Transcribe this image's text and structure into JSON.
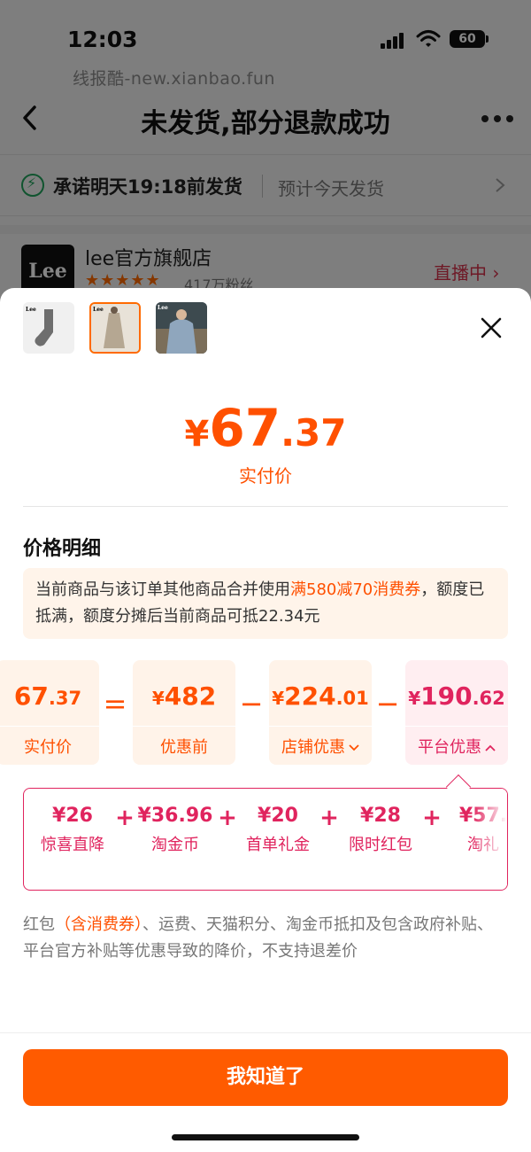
{
  "status_bar": {
    "time": "12:03",
    "battery": "60"
  },
  "watermark": "线报酷-new.xianbao.fun",
  "header": {
    "title": "未发货,部分退款成功"
  },
  "delivery": {
    "promise": "承诺明天19:18前发货",
    "estimate": "预计今天发货"
  },
  "store": {
    "logo_text": "Lee",
    "name": "lee官方旗舰店",
    "fans": "417万粉丝",
    "live_label": "直播中 ›"
  },
  "sheet": {
    "thumbnails": [
      "sock-product",
      "dress-product",
      "jacket-product"
    ],
    "price": {
      "currency": "¥",
      "integer": "67",
      "decimal": ".37",
      "label": "实付价"
    },
    "section_title": "价格明细",
    "notice": {
      "before": "当前商品与该订单其他商品合并使用",
      "highlight": "满580减70消费券",
      "after": "，额度已抵满，额度分摊后当前商品可抵22.34元"
    },
    "formula": [
      {
        "currency": "",
        "integer": "67",
        "decimal": ".37",
        "label": "实付价"
      },
      {
        "currency": "¥",
        "integer": "482",
        "decimal": "",
        "label": "优惠前"
      },
      {
        "currency": "¥",
        "integer": "224",
        "decimal": ".01",
        "label": "店铺优惠"
      },
      {
        "currency": "¥",
        "integer": "190",
        "decimal": ".62",
        "label": "平台优惠"
      }
    ],
    "operators": [
      "=",
      "−",
      "−"
    ],
    "platform_items": [
      {
        "value": "¥26",
        "label": "惊喜直降"
      },
      {
        "value": "¥36.96",
        "label": "淘金币"
      },
      {
        "value": "¥20",
        "label": "首单礼金"
      },
      {
        "value": "¥28",
        "label": "限时红包"
      },
      {
        "value": "¥57.",
        "label": "淘礼"
      }
    ],
    "platform_plus": "+",
    "footnote": {
      "before": "红包",
      "highlight": "（含消费券）",
      "after": "、运费、天猫积分、淘金币抵扣及包含政府补贴、平台官方补贴等优惠导致的降价，不支持退差价"
    },
    "confirm_label": "我知道了"
  },
  "colors": {
    "accent": "#ff5000",
    "platform": "#e0245e",
    "button": "#ff5b00"
  }
}
